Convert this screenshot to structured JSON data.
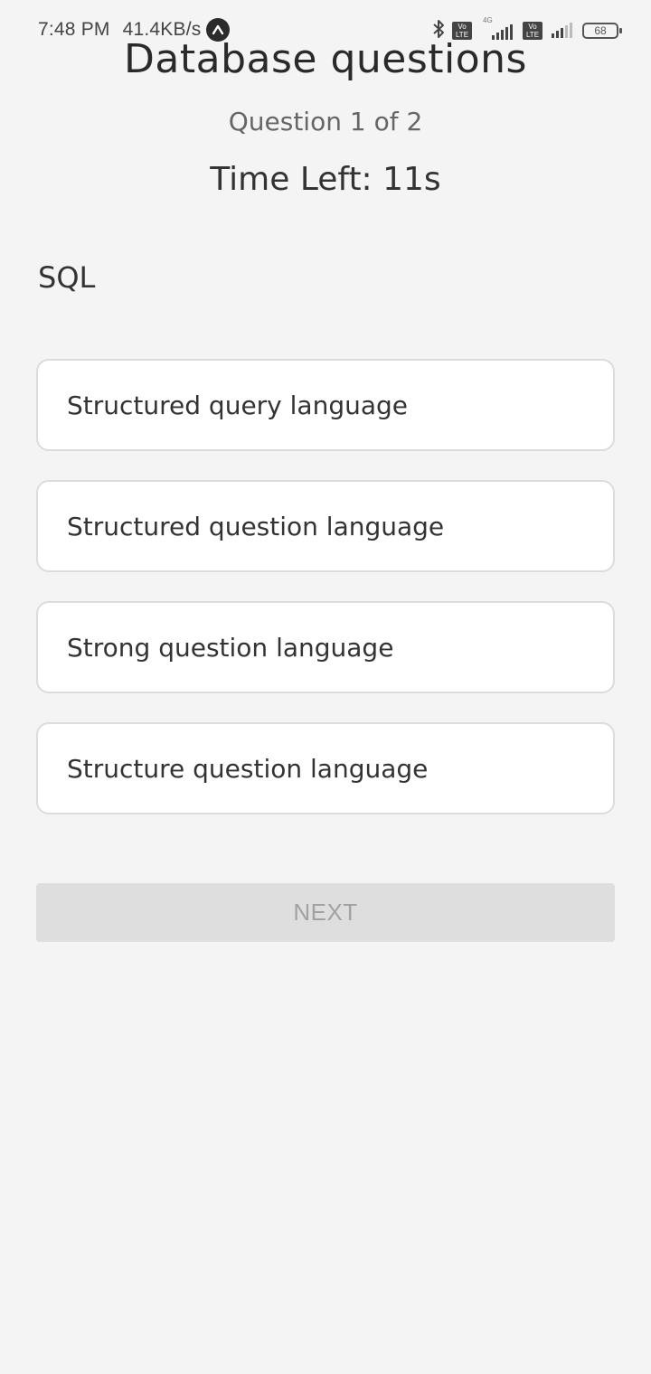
{
  "status_bar": {
    "time": "7:48 PM",
    "net_speed": "41.4KB/s",
    "network_type": "4G",
    "volte_label_top": "Vo",
    "volte_label_bottom": "LTE",
    "battery_level": "68",
    "icons": [
      "app-notification-icon",
      "bluetooth-icon",
      "volte-icon",
      "signal-icon",
      "battery-icon"
    ]
  },
  "header": {
    "title": "Database questions",
    "question_counter": "Question 1 of 2",
    "timer": "Time Left: 11s"
  },
  "question": {
    "text": "SQL",
    "options": [
      "Structured query language",
      "Structured question language",
      "Strong question language",
      "Structure question language"
    ]
  },
  "actions": {
    "next_label": "NEXT",
    "next_enabled": false
  },
  "colors": {
    "background": "#f4f4f4",
    "option_background": "#ffffff",
    "option_border": "#dcdcdc",
    "button_disabled_bg": "#dedede",
    "button_disabled_text": "#a2a2a2"
  }
}
